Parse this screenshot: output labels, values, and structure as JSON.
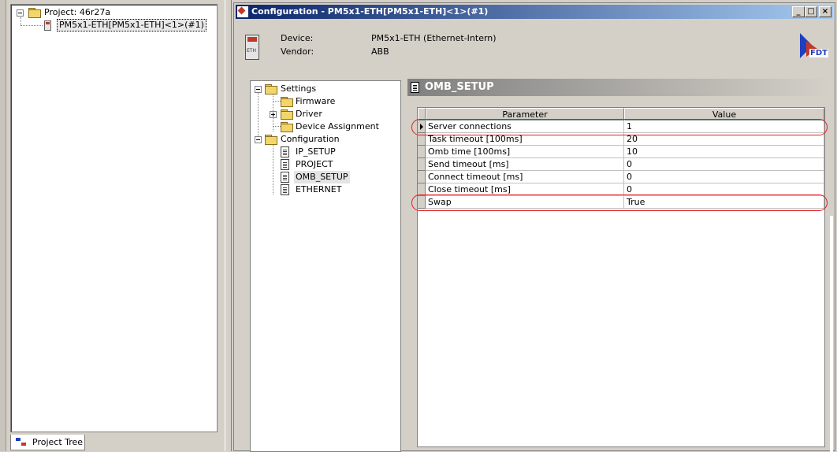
{
  "project_tree": {
    "root_label": "Project: 46r27a",
    "device_label": "PM5x1-ETH[PM5x1-ETH]<1>(#1)",
    "tab_label": "Project Tree"
  },
  "window": {
    "title": "Configuration - PM5x1-ETH[PM5x1-ETH]<1>(#1)",
    "buttons": {
      "minimize": "_",
      "maximize": "□",
      "close": "×"
    }
  },
  "device_info": {
    "device_label": "Device:",
    "device_value": "PM5x1-ETH  (Ethernet-Intern)",
    "vendor_label": "Vendor:",
    "vendor_value": "ABB",
    "logo_text": "FDT"
  },
  "nav_tree": {
    "settings": "Settings",
    "firmware": "Firmware",
    "driver": "Driver",
    "device_assignment": "Device Assignment",
    "configuration": "Configuration",
    "ip_setup": "IP_SETUP",
    "project": "PROJECT",
    "omb_setup": "OMB_SETUP",
    "ethernet": "ETHERNET"
  },
  "section": {
    "title": "OMB_SETUP"
  },
  "params": {
    "header_parameter": "Parameter",
    "header_value": "Value",
    "rows": [
      {
        "name": "Server connections",
        "value": "1"
      },
      {
        "name": "Task timeout [100ms]",
        "value": "20"
      },
      {
        "name": "Omb time [100ms]",
        "value": "10"
      },
      {
        "name": "Send timeout [ms]",
        "value": "0"
      },
      {
        "name": "Connect timeout [ms]",
        "value": "0"
      },
      {
        "name": "Close timeout [ms]",
        "value": "0"
      },
      {
        "name": "Swap",
        "value": "True"
      }
    ]
  },
  "colors": {
    "title_bar_start": "#0a246a",
    "title_bar_end": "#a6caf0",
    "highlight": "#e02020",
    "face": "#d4d0c8"
  }
}
